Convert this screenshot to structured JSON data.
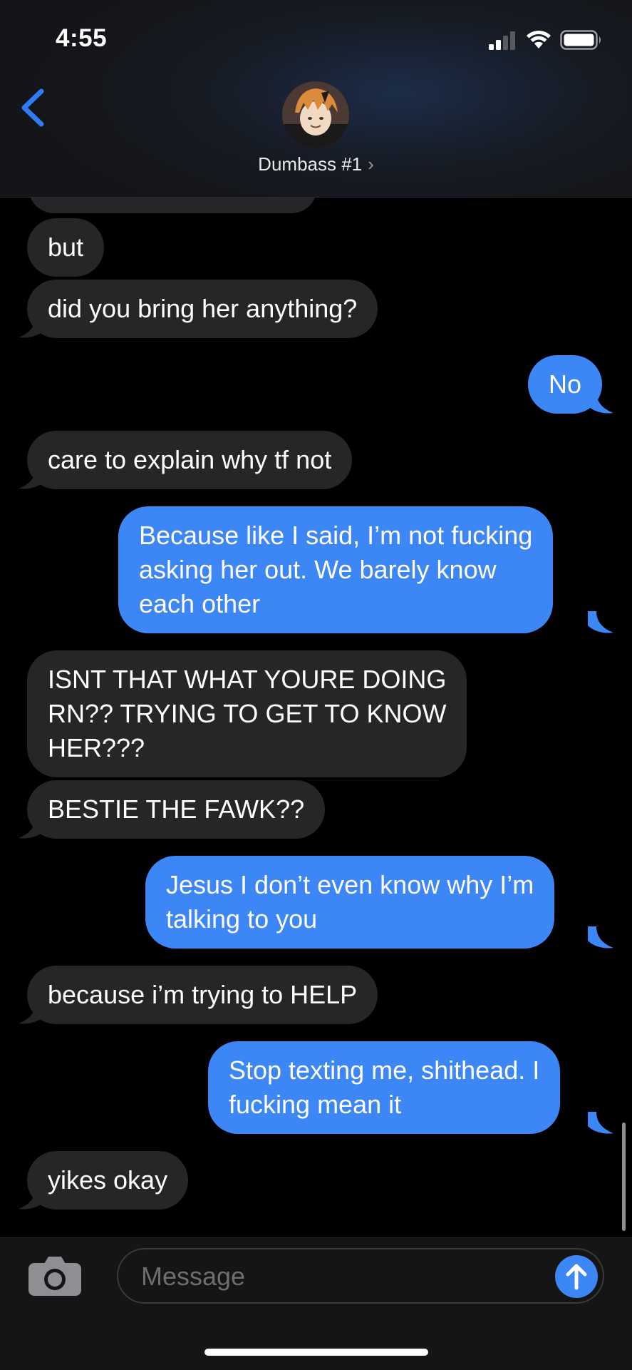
{
  "status_bar": {
    "time": "4:55"
  },
  "header": {
    "contact_name": "Dumbass #1",
    "chevron": "›",
    "avatar_icon": "contact-avatar"
  },
  "messages": [
    {
      "sender": "them",
      "text": "but"
    },
    {
      "sender": "them",
      "text": "did you bring her anything?"
    },
    {
      "sender": "me",
      "text": "No"
    },
    {
      "sender": "them",
      "text": "care to explain why tf not"
    },
    {
      "sender": "me",
      "lines": [
        "Because like I said, I’m not fucking",
        "asking her out. We barely know",
        "each other"
      ]
    },
    {
      "sender": "them",
      "lines": [
        "ISNT THAT WHAT YOURE DOING",
        "RN?? TRYING TO GET TO KNOW",
        "HER???"
      ]
    },
    {
      "sender": "them",
      "text": "BESTIE THE FAWK??"
    },
    {
      "sender": "me",
      "lines": [
        "Jesus I don’t even know why I’m",
        "talking to you"
      ]
    },
    {
      "sender": "them",
      "text": "because i’m trying to HELP"
    },
    {
      "sender": "me",
      "lines": [
        "Stop texting me, shithead. I",
        "fucking mean it"
      ]
    },
    {
      "sender": "them",
      "text": "yikes okay"
    }
  ],
  "composer": {
    "placeholder": "Message",
    "camera_icon": "camera-icon",
    "send_icon": "arrow-up-icon"
  },
  "colors": {
    "sent_bubble": "#3d86f5",
    "received_bubble": "#262629",
    "accent": "#2f7cf6"
  }
}
